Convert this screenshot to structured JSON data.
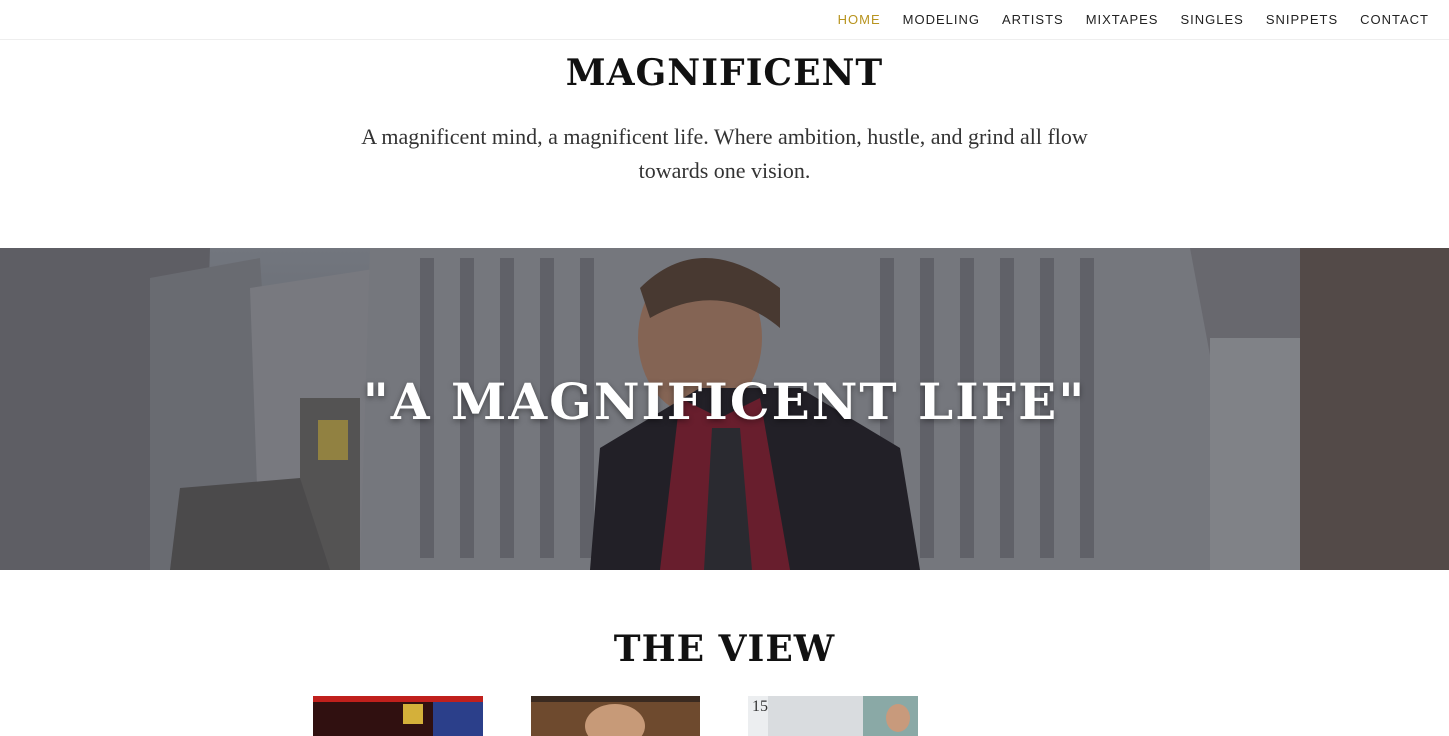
{
  "nav": {
    "items": [
      {
        "label": "HOME",
        "active": true
      },
      {
        "label": "MODELING",
        "active": false
      },
      {
        "label": "ARTISTS",
        "active": false
      },
      {
        "label": "MIXTAPES",
        "active": false
      },
      {
        "label": "SINGLES",
        "active": false
      },
      {
        "label": "SNIPPETS",
        "active": false
      },
      {
        "label": "CONTACT",
        "active": false
      }
    ],
    "active_color": "#b8941f"
  },
  "intro": {
    "title": "MAGNIFICENT",
    "tagline": "A magnificent mind, a magnificent life. Where ambition, hustle, and grind all flow towards one vision."
  },
  "hero": {
    "quote": "\"A MAGNIFICENT LIFE\""
  },
  "view": {
    "title": "THE VIEW",
    "thumb3_label": "15"
  }
}
